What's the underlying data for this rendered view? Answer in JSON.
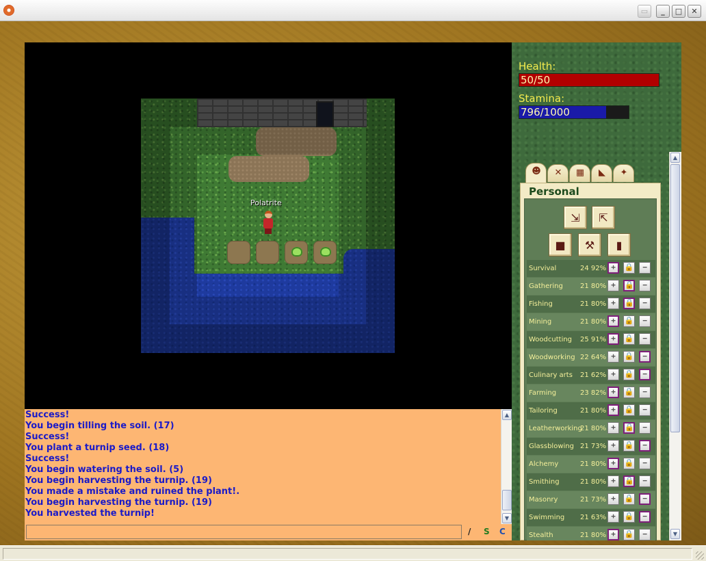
{
  "window": {
    "minimize_glyph": "_",
    "maximize_glyph": "□",
    "close_glyph": "✕",
    "restore_glyph": "▭"
  },
  "map": {
    "player_name": "Polatrite"
  },
  "chat": {
    "lines": [
      "Success!",
      "You begin tilling the soil. (17)",
      "Success!",
      "You plant a turnip seed. (18)",
      "Success!",
      "You begin watering the soil. (5)",
      "You begin harvesting the turnip. (19)",
      "You made a mistake and ruined the plant!.",
      "You begin harvesting the turnip. (19)",
      "You harvested the turnip!"
    ],
    "input_value": "",
    "cmd_slash": "/",
    "cmd_s": "S",
    "cmd_c": "C",
    "text_color": "#1a1ac8",
    "background": "#fdb673"
  },
  "stats": {
    "health_label": "Health:",
    "health_text": "50/50",
    "health_fraction": 1.0,
    "health_color": "#b20000",
    "stamina_label": "Stamina:",
    "stamina_text": "796/1000",
    "stamina_fraction": 0.796,
    "stamina_color": "#1a1aa8"
  },
  "tabs": [
    {
      "icon": "character-icon",
      "glyph": "☻"
    },
    {
      "icon": "crafting-icon",
      "glyph": "✕"
    },
    {
      "icon": "map-icon",
      "glyph": "▦"
    },
    {
      "icon": "inventory-icon",
      "glyph": "◣"
    },
    {
      "icon": "combat-icon",
      "glyph": "✦"
    }
  ],
  "personal": {
    "title": "Personal",
    "tools": [
      {
        "name": "transfer-in-tool",
        "icon": "bag-in-icon",
        "glyph": "⇲"
      },
      {
        "name": "transfer-out-tool",
        "icon": "bag-out-icon",
        "glyph": "⇱"
      },
      {
        "name": "backpack-tool",
        "icon": "backpack-icon",
        "glyph": "■"
      },
      {
        "name": "craft-tool",
        "icon": "tools-icon",
        "glyph": "⚒"
      },
      {
        "name": "stats-tool",
        "icon": "bar-chart-icon",
        "glyph": "▮"
      }
    ],
    "skills": [
      {
        "name": "Survival",
        "value": "24 92%",
        "mode": "raise"
      },
      {
        "name": "Gathering",
        "value": "21 80%",
        "mode": "lock"
      },
      {
        "name": "Fishing",
        "value": "21 80%",
        "mode": "lock"
      },
      {
        "name": "Mining",
        "value": "21 80%",
        "mode": "raise"
      },
      {
        "name": "Woodcutting",
        "value": "25 91%",
        "mode": "raise"
      },
      {
        "name": "Woodworking",
        "value": "22 64%",
        "mode": "lower"
      },
      {
        "name": "Culinary arts",
        "value": "21 62%",
        "mode": "lower"
      },
      {
        "name": "Farming",
        "value": "23 82%",
        "mode": "raise"
      },
      {
        "name": "Tailoring",
        "value": "21 80%",
        "mode": "raise"
      },
      {
        "name": "Leatherworking",
        "value": "21 80%",
        "mode": "lock"
      },
      {
        "name": "Glassblowing",
        "value": "21 73%",
        "mode": "lower"
      },
      {
        "name": "Alchemy",
        "value": "21 80%",
        "mode": "raise"
      },
      {
        "name": "Smithing",
        "value": "21 80%",
        "mode": "lock"
      },
      {
        "name": "Masonry",
        "value": "21 73%",
        "mode": "lower"
      },
      {
        "name": "Swimming",
        "value": "21 63%",
        "mode": "lower"
      },
      {
        "name": "Stealth",
        "value": "21 80%",
        "mode": "raise"
      }
    ],
    "btn_plus": "+",
    "btn_lock": "🔒",
    "btn_minus": "−"
  }
}
